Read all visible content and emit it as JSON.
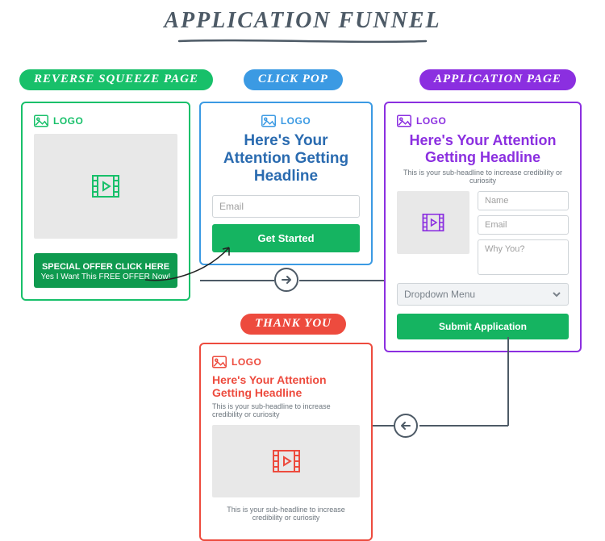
{
  "title": "APPLICATION FUNNEL",
  "labels": {
    "reverse_squeeze": "REVERSE SQUEEZE PAGE",
    "click_pop": "CLICK POP",
    "application": "APPLICATION PAGE",
    "thank_you": "THANK YOU"
  },
  "logo_text": "LOGO",
  "reverse_squeeze": {
    "cta_main": "SPECIAL OFFER CLICK HERE",
    "cta_sub": "Yes I Want This FREE OFFER Now!"
  },
  "click_pop": {
    "headline": "Here's Your Attention Getting Headline",
    "email_placeholder": "Email",
    "cta": "Get Started"
  },
  "application": {
    "headline": "Here's Your Attention Getting Headline",
    "subheadline": "This is your sub-headline to increase credibility or curiosity",
    "fields": {
      "name": "Name",
      "email": "Email",
      "why": "Why You?",
      "dropdown": "Dropdown Menu"
    },
    "cta": "Submit Application"
  },
  "thank_you": {
    "headline": "Here's Your Attention Getting Headline",
    "subheadline_top": "This is your sub-headline to increase credibility or curiosity",
    "subheadline_bottom": "This is your sub-headline to increase credibility or curiosity"
  },
  "colors": {
    "green": "#18c06a",
    "blue": "#3b9ae3",
    "purple": "#8b2fe0",
    "red": "#ed4b3e",
    "gray": "#4d5a66"
  }
}
